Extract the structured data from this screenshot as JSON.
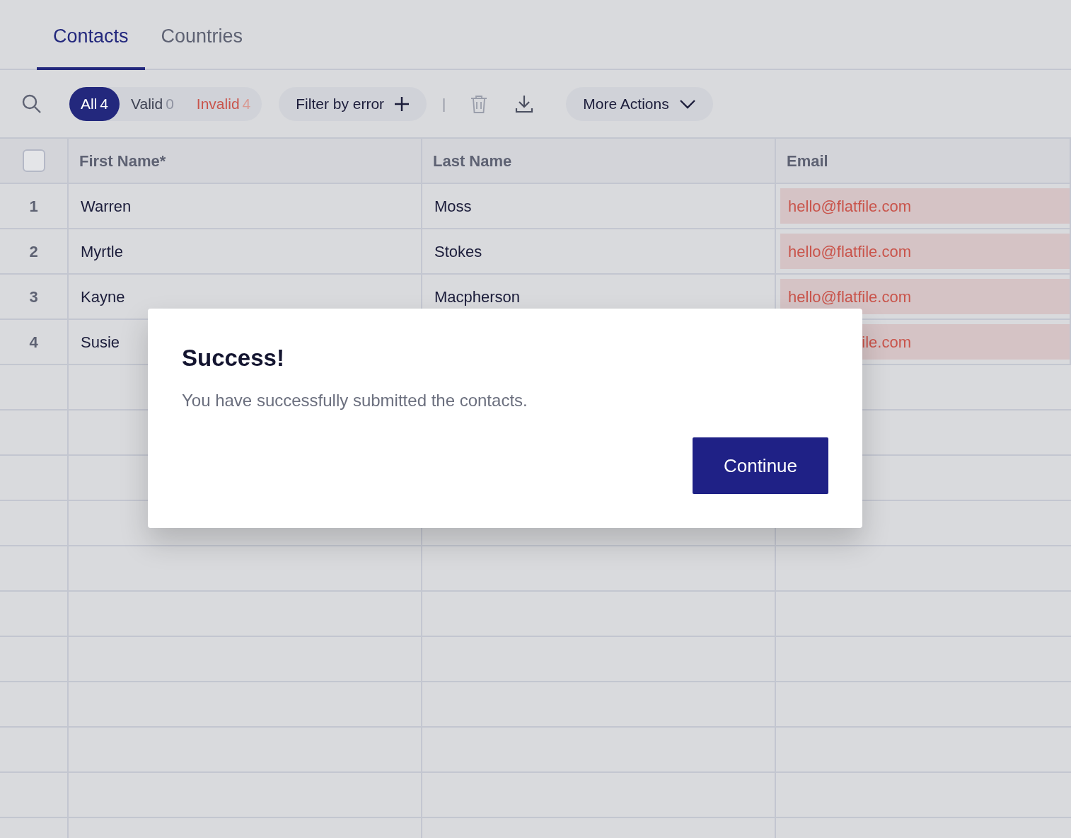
{
  "tabs": [
    {
      "label": "Contacts",
      "selected": true
    },
    {
      "label": "Countries",
      "selected": false
    }
  ],
  "filters": [
    {
      "label": "All",
      "count": "4",
      "kind": "all",
      "selected": true
    },
    {
      "label": "Valid",
      "count": "0",
      "kind": "valid",
      "selected": false
    },
    {
      "label": "Invalid",
      "count": "4",
      "kind": "invalid",
      "selected": false
    }
  ],
  "filter_by_error": {
    "label": "Filter by error"
  },
  "separator": "|",
  "more_actions": {
    "label": "More Actions"
  },
  "table": {
    "select_all_checked": false,
    "columns": [
      "First Name*",
      "Last Name",
      "Email"
    ],
    "rows": [
      {
        "index": "1",
        "cells": [
          "Warren",
          "Moss",
          "hello@flatfile.com"
        ],
        "errors": [
          false,
          false,
          true
        ]
      },
      {
        "index": "2",
        "cells": [
          "Myrtle",
          "Stokes",
          "hello@flatfile.com"
        ],
        "errors": [
          false,
          false,
          true
        ]
      },
      {
        "index": "3",
        "cells": [
          "Kayne",
          "Macpherson",
          "hello@flatfile.com"
        ],
        "errors": [
          false,
          false,
          true
        ]
      },
      {
        "index": "4",
        "cells": [
          "Susie",
          "",
          "ile.com"
        ],
        "errors": [
          false,
          false,
          true
        ]
      }
    ]
  },
  "dialog": {
    "title": "Success!",
    "message": "You have successfully submitted the contacts.",
    "button": "Continue"
  }
}
